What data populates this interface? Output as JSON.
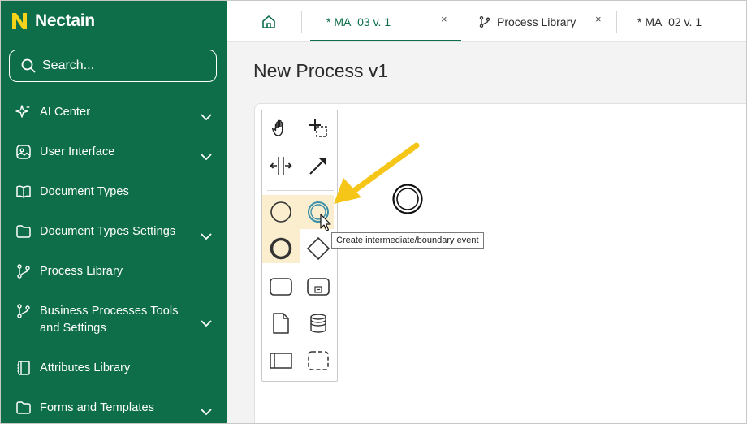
{
  "app": {
    "brand": "Nectain"
  },
  "search": {
    "placeholder": "Search..."
  },
  "sidebar": {
    "items": [
      {
        "label": "AI Center",
        "icon": "sparkle-icon",
        "expandable": true
      },
      {
        "label": "User Interface",
        "icon": "image-icon",
        "expandable": true
      },
      {
        "label": "Document Types",
        "icon": "book-icon",
        "expandable": false
      },
      {
        "label": "Document Types Settings",
        "icon": "folder-icon",
        "expandable": true
      },
      {
        "label": "Process Library",
        "icon": "branch-icon",
        "expandable": false
      },
      {
        "label": "Business Processes Tools and Settings",
        "icon": "branch-icon",
        "expandable": true
      },
      {
        "label": "Attributes Library",
        "icon": "notebook-icon",
        "expandable": false
      },
      {
        "label": "Forms and Templates",
        "icon": "folder-icon",
        "expandable": true
      }
    ]
  },
  "tabs": [
    {
      "label": "* MA_03 v. 1",
      "active": true,
      "close": "×"
    },
    {
      "label": "Process Library",
      "active": false,
      "close": "×"
    },
    {
      "label": "* MA_02 v. 1",
      "active": false
    }
  ],
  "main": {
    "title": "New Process v1"
  },
  "palette": {
    "tools": [
      "hand-tool-icon",
      "lasso-tool-icon",
      "space-tool-icon",
      "connect-tool-icon",
      "start-event-icon",
      "intermediate-event-icon",
      "end-event-icon",
      "gateway-icon",
      "task-icon",
      "subprocess-icon",
      "data-object-icon",
      "data-store-icon",
      "pool-icon",
      "group-icon"
    ]
  },
  "tooltip": {
    "text": "Create intermediate/boundary event"
  },
  "colors": {
    "brand": "#0e6e4a",
    "accent": "#f5c518",
    "highlight": "#fbeecf"
  }
}
